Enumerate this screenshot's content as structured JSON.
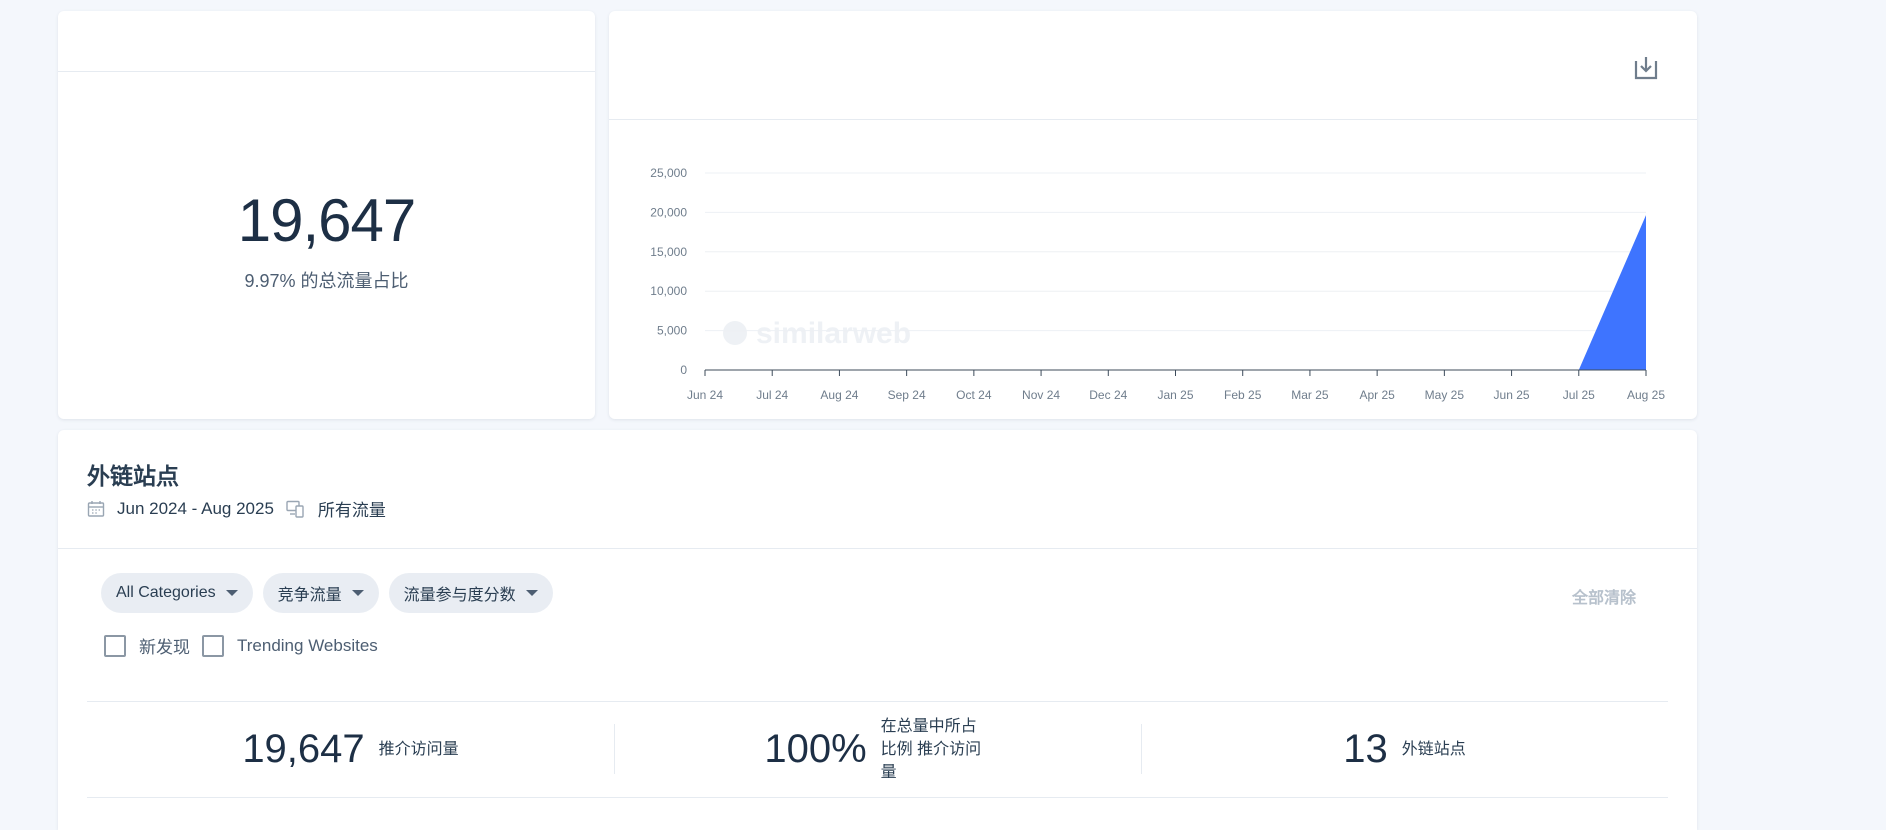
{
  "kpi": {
    "value": "19,647",
    "share_text": "9.97% 的总流量占比"
  },
  "chart_data": {
    "type": "area",
    "x": [
      "Jun 24",
      "Jul 24",
      "Aug 24",
      "Sep 24",
      "Oct 24",
      "Nov 24",
      "Dec 24",
      "Jan 25",
      "Feb 25",
      "Mar 25",
      "Apr 25",
      "May 25",
      "Jun 25",
      "Jul 25",
      "Aug 25"
    ],
    "values": [
      0,
      0,
      0,
      0,
      0,
      0,
      0,
      0,
      0,
      0,
      0,
      0,
      0,
      0,
      19647
    ],
    "ylim": [
      0,
      25000
    ],
    "yticks": [
      "0",
      "5,000",
      "10,000",
      "15,000",
      "20,000",
      "25,000"
    ],
    "ytick_values": [
      0,
      5000,
      10000,
      15000,
      20000,
      25000
    ],
    "watermark": "similarweb",
    "grid": true,
    "color": "#3e74ff"
  },
  "chart_card": {
    "download_icon": "download-icon"
  },
  "backlinks": {
    "title": "外链站点",
    "date_range": "Jun 2024 - Aug 2025",
    "traffic_scope": "所有流量",
    "filters": [
      "All Categories",
      "竞争流量",
      "流量参与度分数"
    ],
    "clear_all": "全部清除",
    "checkboxes": [
      "新发现",
      "Trending Websites"
    ],
    "summary": [
      {
        "value": "19,647",
        "label": "推介访问量"
      },
      {
        "value": "100%",
        "label": "在总量中所占比例 推介访问量"
      },
      {
        "value": "13",
        "label": "外链站点"
      }
    ]
  }
}
